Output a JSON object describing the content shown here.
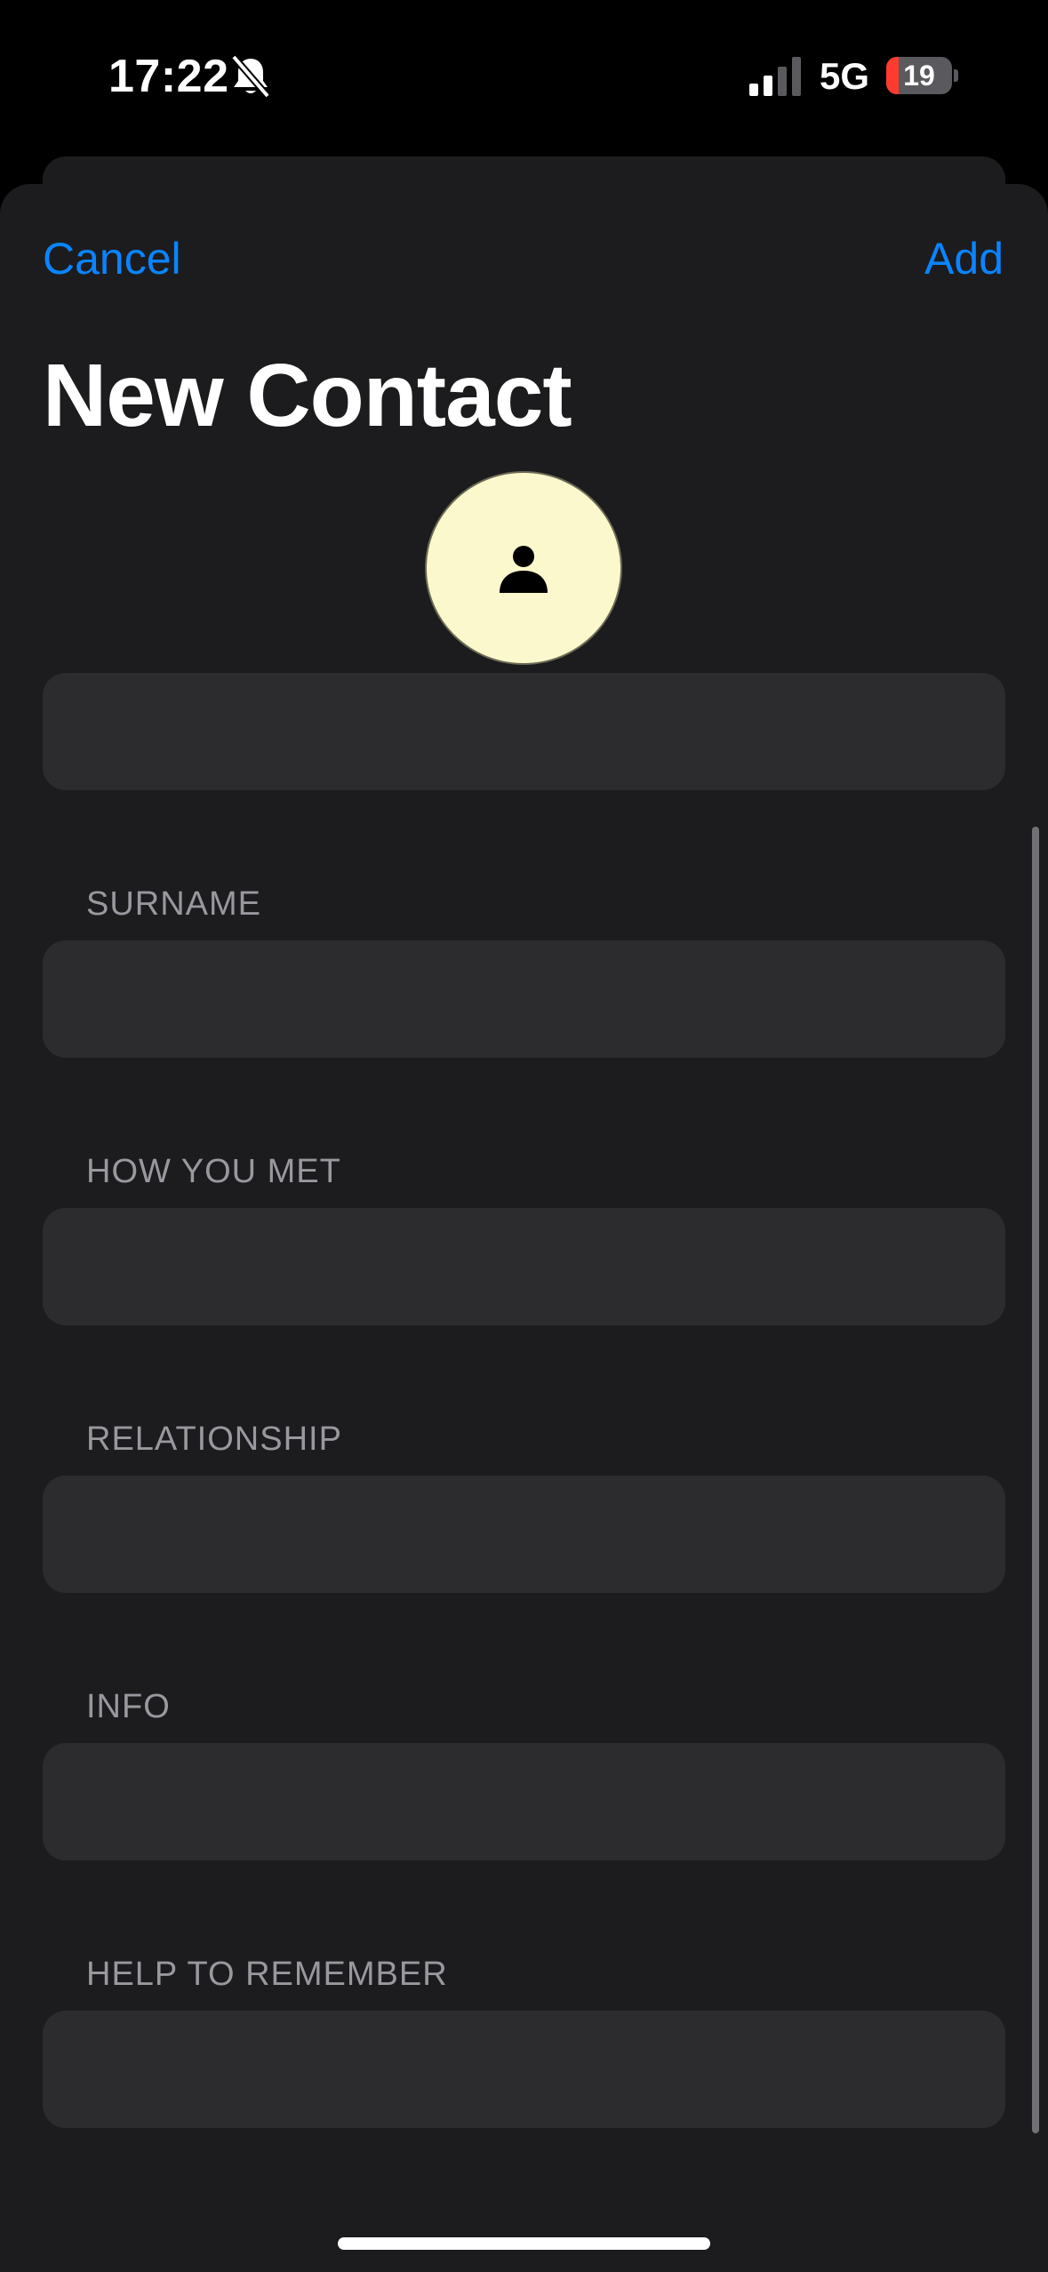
{
  "status_bar": {
    "time": "17:22",
    "network": "5G",
    "battery_level": "19",
    "battery_fraction": 0.19,
    "icons": [
      "bell-slash-icon",
      "cellular-signal-icon",
      "battery-icon"
    ]
  },
  "nav": {
    "cancel_label": "Cancel",
    "add_label": "Add"
  },
  "page": {
    "title": "New Contact"
  },
  "avatar": {
    "icon": "person-icon",
    "background_color": "#fbf8cd"
  },
  "form": {
    "name_value": "",
    "fields": [
      {
        "label": "SURNAME",
        "value": ""
      },
      {
        "label": "HOW YOU MET",
        "value": ""
      },
      {
        "label": "RELATIONSHIP",
        "value": ""
      },
      {
        "label": "INFO",
        "value": ""
      },
      {
        "label": "HELP TO REMEMBER",
        "value": ""
      }
    ]
  },
  "colors": {
    "accent": "#0a84ff",
    "background": "#1c1c1e",
    "field_background": "#2c2c2e",
    "label": "#98989f",
    "battery_low": "#ff3b30"
  }
}
